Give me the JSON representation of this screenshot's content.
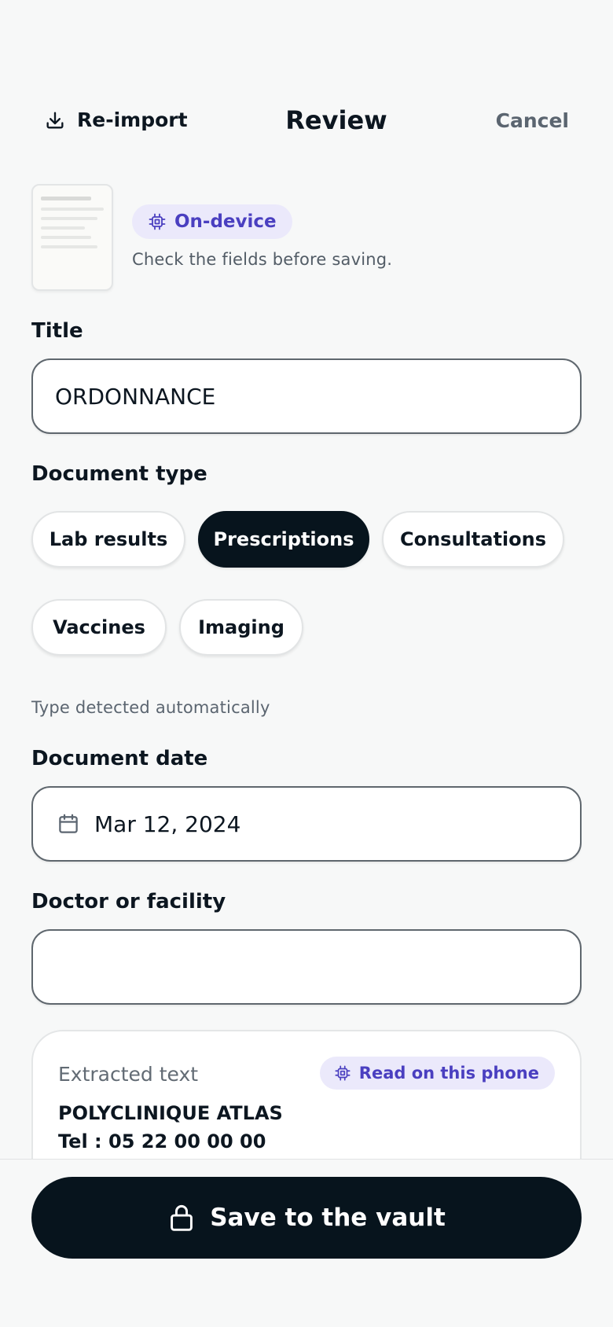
{
  "header": {
    "reimport_label": "Re-import",
    "title": "Review",
    "cancel_label": "Cancel"
  },
  "preview": {
    "badge_label": "On-device",
    "subtitle": "Check the fields before saving."
  },
  "form": {
    "title_label": "Title",
    "title_value": "ORDONNANCE",
    "type_label": "Document type",
    "types": [
      {
        "label": "Lab results",
        "selected": false
      },
      {
        "label": "Prescriptions",
        "selected": true
      },
      {
        "label": "Consultations",
        "selected": false
      },
      {
        "label": "Vaccines",
        "selected": false
      },
      {
        "label": "Imaging",
        "selected": false
      }
    ],
    "type_hint": "Type detected automatically",
    "date_label": "Document date",
    "date_value": "Mar 12, 2024",
    "doctor_label": "Doctor or facility",
    "doctor_value": ""
  },
  "extracted": {
    "title": "Extracted text",
    "badge_label": "Read on this phone",
    "lines": [
      "POLYCLINIQUE ATLAS",
      "Tel : 05 22 00 00 00"
    ]
  },
  "footer": {
    "save_label": "Save to the vault"
  },
  "colors": {
    "accent": "#4a3fc0",
    "accent_bg": "#ebe9fb",
    "primary_dark": "#07141d",
    "background": "#f7f8f8"
  }
}
